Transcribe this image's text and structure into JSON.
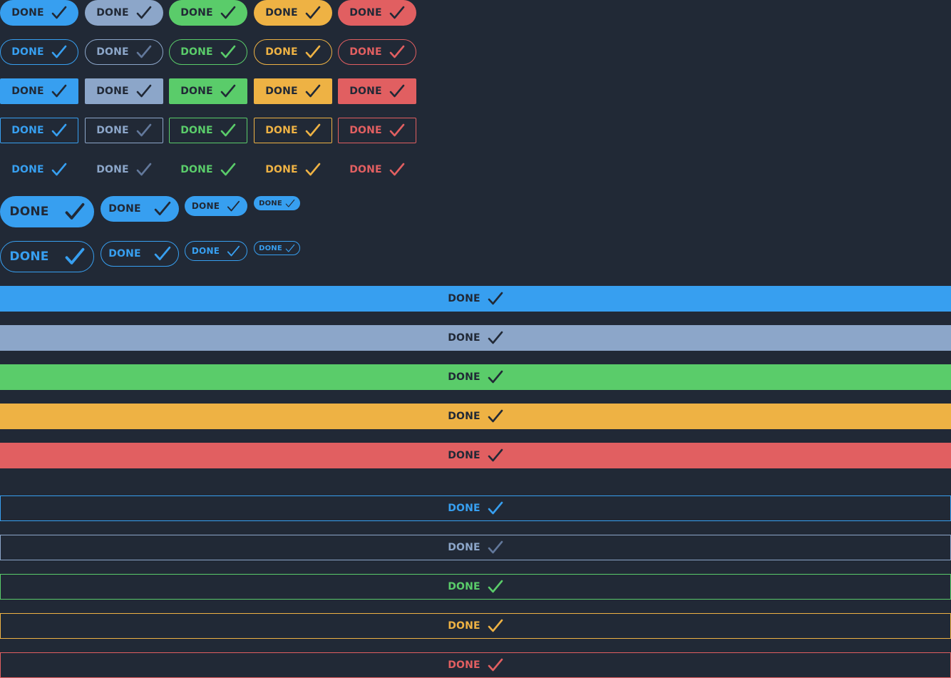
{
  "label": "DONE",
  "colors": {
    "background": "#212936",
    "blue": "#379ff0",
    "gray": "#8ca6c9",
    "gray_icon": "#62789b",
    "green": "#5acc6a",
    "yellow": "#eeb244",
    "red": "#e15f61",
    "dark": "#212936"
  },
  "palette": [
    "blue",
    "gray",
    "green",
    "yellow",
    "red"
  ],
  "rows": [
    {
      "style": "filled",
      "shape": "pill"
    },
    {
      "style": "outline",
      "shape": "pill"
    },
    {
      "style": "filled",
      "shape": "square"
    },
    {
      "style": "outline",
      "shape": "square"
    },
    {
      "style": "text",
      "shape": "none"
    }
  ],
  "size_rows": [
    {
      "style": "filled",
      "color": "blue",
      "sizes": [
        "xl",
        "lg",
        "md",
        "sm"
      ]
    },
    {
      "style": "outline",
      "color": "blue",
      "sizes": [
        "xl",
        "lg",
        "md",
        "sm"
      ]
    }
  ],
  "block_rows": [
    {
      "style": "filled",
      "colors": [
        "blue",
        "gray",
        "green",
        "yellow",
        "red"
      ]
    },
    {
      "style": "outline",
      "colors": [
        "blue",
        "gray",
        "green",
        "yellow",
        "red"
      ]
    }
  ],
  "icon": "check-icon"
}
